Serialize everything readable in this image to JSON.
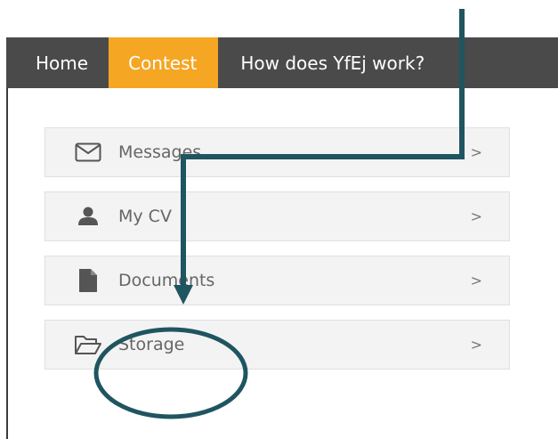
{
  "nav": {
    "items": [
      {
        "label": "Home"
      },
      {
        "label": "Contest",
        "active": true
      },
      {
        "label": "How does YfEj work?"
      }
    ],
    "active_color": "#f5a623",
    "bar_color": "#4a4a4a"
  },
  "menu": {
    "items": [
      {
        "label": "Messages",
        "icon": "envelope-icon",
        "chevron": ">"
      },
      {
        "label": "My CV",
        "icon": "user-icon",
        "chevron": ">"
      },
      {
        "label": "Documents",
        "icon": "document-icon",
        "chevron": ">"
      },
      {
        "label": "Storage",
        "icon": "folder-open-icon",
        "chevron": ">"
      }
    ]
  },
  "annotation": {
    "color": "#1f5560"
  }
}
